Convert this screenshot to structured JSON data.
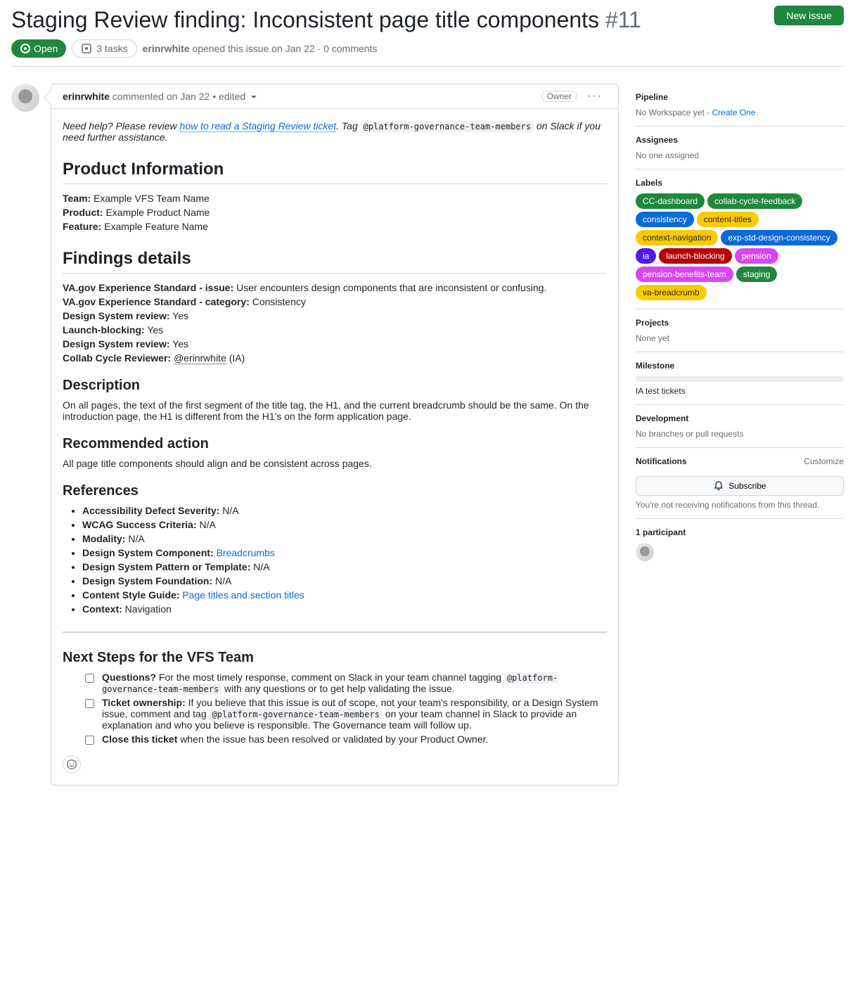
{
  "issue": {
    "title": "Staging Review finding: Inconsistent page title components",
    "number": "#11",
    "new_issue_label": "New issue",
    "state_label": "Open",
    "tasks_label": "3 tasks",
    "opener_author": "erinrwhite",
    "opened_text": "opened this issue on Jan 22 · 0 comments"
  },
  "comment": {
    "author": "erinrwhite",
    "meta": "commented on Jan 22 • edited",
    "role": "Owner",
    "hint_prefix": "Need help? Please review ",
    "hint_link": "how to read a Staging Review ticket",
    "hint_suffix": ". Tag ",
    "hint_tag": "@platform-governance-team-members",
    "hint_tail": " on Slack if you need further assistance.",
    "h_product_info": "Product Information",
    "team_label": "Team:",
    "team_value": "Example VFS Team Name",
    "product_label": "Product:",
    "product_value": "Example Product Name",
    "feature_label": "Feature:",
    "feature_value": "Example Feature Name",
    "h_findings": "Findings details",
    "fd_issue_label": "VA.gov Experience Standard - issue:",
    "fd_issue_value": "User encounters design components that are inconsistent or confusing.",
    "fd_cat_label": "VA.gov Experience Standard - category:",
    "fd_cat_value": "Consistency",
    "fd_dsr_label": "Design System review:",
    "fd_dsr_value": "Yes",
    "fd_lb_label": "Launch-blocking:",
    "fd_lb_value": "Yes",
    "fd_dsr2_label": "Design System review:",
    "fd_dsr2_value": "Yes",
    "fd_rev_label": "Collab Cycle Reviewer:",
    "fd_rev_value": "@erinrwhite",
    "fd_rev_suffix": " (IA)",
    "h_description": "Description",
    "description_text": "On all pages, the text of the first segment of the title tag, the H1, and the current breadcrumb should be the same. On the introduction page, the H1 is different from the H1's on the form application page.",
    "h_recommended": "Recommended action",
    "recommended_text": "All page title components should align and be consistent across pages.",
    "h_references": "References",
    "refs": {
      "a11y_label": "Accessibility Defect Severity:",
      "a11y_value": "N/A",
      "wcag_label": "WCAG Success Criteria:",
      "wcag_value": "N/A",
      "modality_label": "Modality:",
      "modality_value": "N/A",
      "component_label": "Design System Component:",
      "component_link": "Breadcrumbs",
      "pattern_label": "Design System Pattern or Template:",
      "pattern_value": "N/A",
      "foundation_label": "Design System Foundation:",
      "foundation_value": "N/A",
      "csg_label": "Content Style Guide:",
      "csg_link": "Page titles and section titles",
      "context_label": "Context:",
      "context_value": "Navigation"
    },
    "h_next_steps": "Next Steps for the VFS Team",
    "task1_bold": "Questions?",
    "task1_text_a": " For the most timely response, comment on Slack in your team channel tagging ",
    "task1_code": "@platform-governance-team-members",
    "task1_text_b": " with any questions or to get help validating the issue.",
    "task2_bold": "Ticket ownership:",
    "task2_text_a": " If you believe that this issue is out of scope, not your team's responsibility, or a Design System issue, comment and tag ",
    "task2_code": "@platform-governance-team-members",
    "task2_text_b": " on your team channel in Slack to provide an explanation and who you believe is responsible. The Governance team will follow up.",
    "task3_bold": "Close this ticket",
    "task3_text": " when the issue has been resolved or validated by your Product Owner."
  },
  "sidebar": {
    "pipeline_title": "Pipeline",
    "pipeline_text": "No Workspace yet - ",
    "pipeline_link": "Create One",
    "assignees_title": "Assignees",
    "assignees_text": "No one assigned",
    "labels_title": "Labels",
    "labels": [
      {
        "text": "CC-dashboard",
        "bg": "#1f883d",
        "fg": "#ffffff"
      },
      {
        "text": "collab-cycle-feedback",
        "bg": "#1f883d",
        "fg": "#ffffff"
      },
      {
        "text": "consistency",
        "bg": "#0969da",
        "fg": "#ffffff"
      },
      {
        "text": "content-titles",
        "bg": "#fbca04",
        "fg": "#24292f"
      },
      {
        "text": "context-navigation",
        "bg": "#fbca04",
        "fg": "#24292f"
      },
      {
        "text": "exp-std-design-consistency",
        "bg": "#0969da",
        "fg": "#ffffff"
      },
      {
        "text": "ia",
        "bg": "#5319e7",
        "fg": "#ffffff"
      },
      {
        "text": "launch-blocking",
        "bg": "#b60205",
        "fg": "#ffffff"
      },
      {
        "text": "pension",
        "bg": "#d946ef",
        "fg": "#ffffff"
      },
      {
        "text": "pension-benefits-team",
        "bg": "#d946ef",
        "fg": "#ffffff"
      },
      {
        "text": "staging",
        "bg": "#1f883d",
        "fg": "#ffffff"
      },
      {
        "text": "va-breadcrumb",
        "bg": "#fbca04",
        "fg": "#24292f"
      }
    ],
    "projects_title": "Projects",
    "projects_text": "None yet",
    "milestone_title": "Milestone",
    "milestone_text": "IA test tickets",
    "development_title": "Development",
    "development_text": "No branches or pull requests",
    "notifications_title": "Notifications",
    "customize": "Customize",
    "subscribe": "Subscribe",
    "notifications_text": "You're not receiving notifications from this thread.",
    "participants_title": "1 participant"
  }
}
